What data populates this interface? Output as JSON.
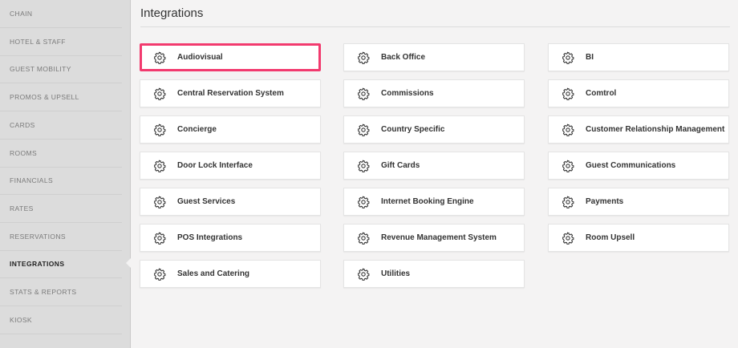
{
  "sidebar": {
    "items": [
      {
        "label": "CHAIN"
      },
      {
        "label": "HOTEL & STAFF"
      },
      {
        "label": "GUEST MOBILITY"
      },
      {
        "label": "PROMOS & UPSELL"
      },
      {
        "label": "CARDS"
      },
      {
        "label": "ROOMS"
      },
      {
        "label": "FINANCIALS"
      },
      {
        "label": "RATES"
      },
      {
        "label": "RESERVATIONS"
      },
      {
        "label": "INTEGRATIONS"
      },
      {
        "label": "STATS & REPORTS"
      },
      {
        "label": "KIOSK"
      }
    ],
    "active_item": "INTEGRATIONS"
  },
  "main": {
    "title": "Integrations",
    "selected_card": "Audiovisual",
    "highlight_color": "#f23a6e",
    "card_icon": "gear-icon",
    "cards": [
      {
        "label": "Audiovisual"
      },
      {
        "label": "Back Office"
      },
      {
        "label": "BI"
      },
      {
        "label": "Central Reservation System"
      },
      {
        "label": "Commissions"
      },
      {
        "label": "Comtrol"
      },
      {
        "label": "Concierge"
      },
      {
        "label": "Country Specific"
      },
      {
        "label": "Customer Relationship Management"
      },
      {
        "label": "Door Lock Interface"
      },
      {
        "label": "Gift Cards"
      },
      {
        "label": "Guest Communications"
      },
      {
        "label": "Guest Services"
      },
      {
        "label": "Internet Booking Engine"
      },
      {
        "label": "Payments"
      },
      {
        "label": "POS Integrations"
      },
      {
        "label": "Revenue Management System"
      },
      {
        "label": "Room Upsell"
      },
      {
        "label": "Sales and Catering"
      },
      {
        "label": "Utilities"
      }
    ]
  }
}
